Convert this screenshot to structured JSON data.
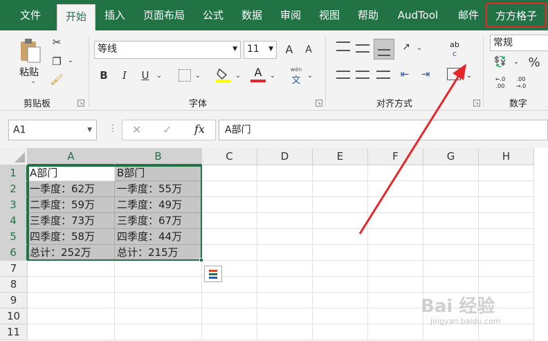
{
  "tabs": [
    {
      "label": "文件",
      "active": false
    },
    {
      "label": "开始",
      "active": true
    },
    {
      "label": "插入",
      "active": false
    },
    {
      "label": "页面布局",
      "active": false
    },
    {
      "label": "公式",
      "active": false
    },
    {
      "label": "数据",
      "active": false
    },
    {
      "label": "审阅",
      "active": false
    },
    {
      "label": "视图",
      "active": false
    },
    {
      "label": "帮助",
      "active": false
    },
    {
      "label": "AudTool",
      "active": false
    },
    {
      "label": "邮件",
      "active": false
    },
    {
      "label": "方方格子",
      "active": false,
      "highlighted": true
    }
  ],
  "ribbon": {
    "clipboard": {
      "label": "剪贴板",
      "paste_label": "粘贴"
    },
    "font": {
      "label": "字体",
      "font_name": "等线",
      "font_size": "11",
      "grow_icon": "A",
      "shrink_icon": "A",
      "bold": "B",
      "italic": "I",
      "underline": "U",
      "font_color_glyph": "A",
      "phonetic_top": "wén",
      "phonetic_bottom": "文"
    },
    "alignment": {
      "label": "对齐方式",
      "wrap_glyph_top": "ab",
      "wrap_glyph_bottom": "c"
    },
    "number": {
      "label": "数字",
      "format": "常规",
      "percent": "%",
      "inc_decimal_top": "←.0",
      "inc_decimal_bottom": ".00",
      "dec_decimal_top": ".00",
      "dec_decimal_bottom": "→.0"
    }
  },
  "formula_bar": {
    "name_box": "A1",
    "cancel": "✕",
    "enter": "✓",
    "fx": "fx",
    "content": "A部门"
  },
  "columns": [
    "A",
    "B",
    "C",
    "D",
    "E",
    "F",
    "G",
    "H"
  ],
  "rows": [
    "1",
    "2",
    "3",
    "4",
    "5",
    "6",
    "7",
    "8",
    "9",
    "10",
    "11"
  ],
  "cells": {
    "A": [
      "A部门",
      "一季度：62万",
      "二季度：59万",
      "三季度：73万",
      "四季度：58万",
      "总计：252万"
    ],
    "B": [
      "B部门",
      "一季度：55万",
      "二季度：49万",
      "三季度：67万",
      "四季度：44万",
      "总计：215万"
    ]
  },
  "colors": {
    "excel_green": "#217346",
    "highlight_red": "#e8262a",
    "selection_gray": "#c6c6c6"
  },
  "watermark": {
    "text": "Bai 经验",
    "sub": "jingyan.baidu.com"
  }
}
